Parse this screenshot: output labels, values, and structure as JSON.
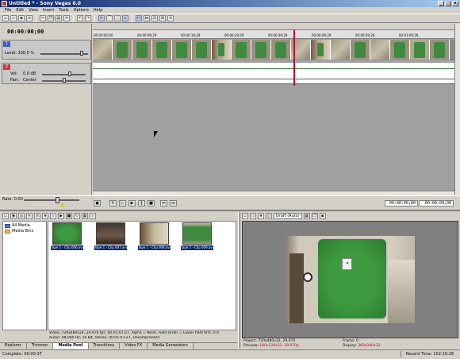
{
  "window": {
    "title": "Untitled * - Sony Vegas 6.0",
    "min": "_",
    "max": "□",
    "close": "x"
  },
  "menu": [
    "File",
    "Edit",
    "View",
    "Insert",
    "Tools",
    "Options",
    "Help"
  ],
  "toolbar": {
    "icons": [
      "new-icon",
      "open-icon",
      "save-icon",
      "properties-icon",
      "cut-icon",
      "copy-icon",
      "paste-icon",
      "delete-icon",
      "undo-icon",
      "redo-icon",
      "normal-edit-tool-icon",
      "envelope-tool-icon",
      "selection-tool-icon",
      "zoom-tool-icon",
      "snapping-icon",
      "auto-crossfade-icon",
      "lock-envelopes-icon",
      "ignore-grouping-icon",
      "auto-ripple-icon"
    ]
  },
  "timeline": {
    "cursor_time": "00:00:00;00",
    "ruler_labels": [
      "00:00:00;00",
      "00:00:09;29",
      "00:00:19;29",
      "00:00:29;29",
      "00:00:39;29",
      "00:00:49;29",
      "00:00:59;28",
      "00:01:09;28"
    ],
    "video_track": {
      "number": "1",
      "level_label": "Level: 100.0 %"
    },
    "audio_track": {
      "number": "2",
      "vol_label": "Vol:",
      "vol_value": "0.0 dB",
      "pan_label": "Pan:",
      "pan_value": "Center"
    },
    "rate_label": "Rate: 0.00",
    "transport_time": "00:00:00;00",
    "transport_end": "00:00:00;00"
  },
  "media_pool": {
    "tree": [
      "All Media",
      "Media Bins"
    ],
    "files": [
      {
        "caption": "Tape 1 - Clip 006.avi"
      },
      {
        "caption": "Tape 1 - Clip 007.avi"
      },
      {
        "caption": "Tape 1 - Clip 008.avi"
      },
      {
        "caption": "Tape 1 - Clip 009.avi"
      }
    ],
    "info_line1": "Video: 720x480x24, 29.970 fps, 00:01:07;27, Alpha = None, Field Order = Lower field first, 0.9",
    "info_line2": "Audio: 48,000 Hz, 16 Bit, Stereo, 00:01:07;27, Uncompressed"
  },
  "tabs": [
    "Explorer",
    "Trimmer",
    "Media Pool",
    "Transitions",
    "Video FX",
    "Media Generators"
  ],
  "active_tab": "Media Pool",
  "preview": {
    "quality": "Draft (Auto)",
    "project_label": "Project:",
    "project_value": "720x480x32, 29.970",
    "preview_label": "Preview:",
    "preview_value": "180x120x32, 29.970p",
    "frame_label": "Frame:",
    "frame_value": "0",
    "display_label": "Display:",
    "display_value": "360x240x32"
  },
  "status": {
    "left": "Complete: 00:00:37",
    "right": "Record Time: 102:10:28"
  }
}
